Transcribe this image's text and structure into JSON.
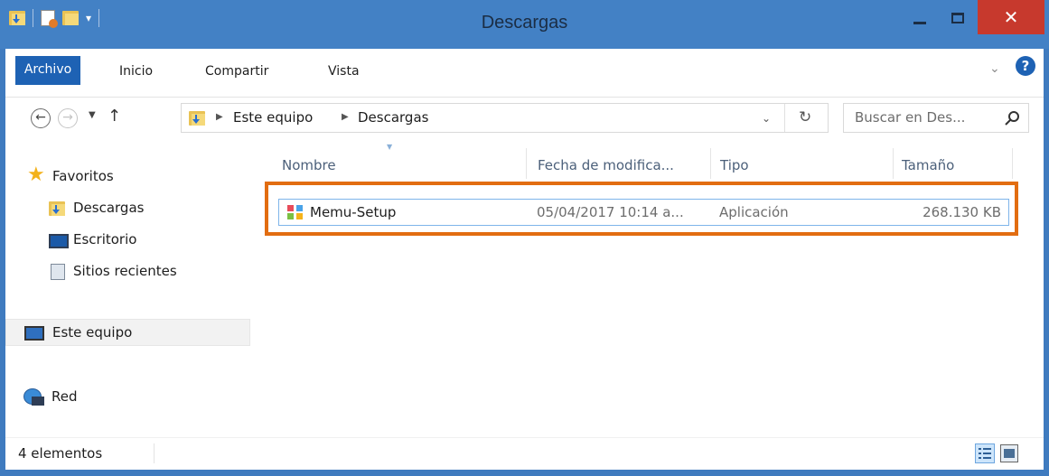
{
  "window": {
    "title": "Descargas"
  },
  "ribbon": {
    "tabs": [
      {
        "label": "Archivo"
      },
      {
        "label": "Inicio"
      },
      {
        "label": "Compartir"
      },
      {
        "label": "Vista"
      }
    ]
  },
  "address": {
    "crumbs": [
      "Este equipo",
      "Descargas"
    ],
    "search_placeholder": "Buscar en Des..."
  },
  "nav_pane": {
    "favorites": {
      "label": "Favoritos"
    },
    "items": [
      {
        "label": "Descargas"
      },
      {
        "label": "Escritorio"
      },
      {
        "label": "Sitios recientes"
      }
    ],
    "this_pc": {
      "label": "Este equipo"
    },
    "network": {
      "label": "Red"
    }
  },
  "files": {
    "columns": [
      "Nombre",
      "Fecha de modifica...",
      "Tipo",
      "Tamaño"
    ],
    "rows": [
      {
        "name": "Memu-Setup",
        "modified": "05/04/2017 10:14 a...",
        "type": "Aplicación",
        "size": "268.130 KB"
      }
    ]
  },
  "status": {
    "count_text": "4 elementos"
  },
  "colors": {
    "title_bar": "#4381c5",
    "file_tab": "#1e62b4",
    "close_button": "#c7392d",
    "highlight_box": "#e26d11",
    "selection_border": "#7eb4ea"
  },
  "icons": {
    "folder": "folder-download-icon",
    "favorites": "star-icon",
    "desktop": "desktop-icon",
    "recent": "recent-places-icon",
    "this_pc": "computer-icon",
    "network": "network-icon",
    "app": "application-icon"
  }
}
